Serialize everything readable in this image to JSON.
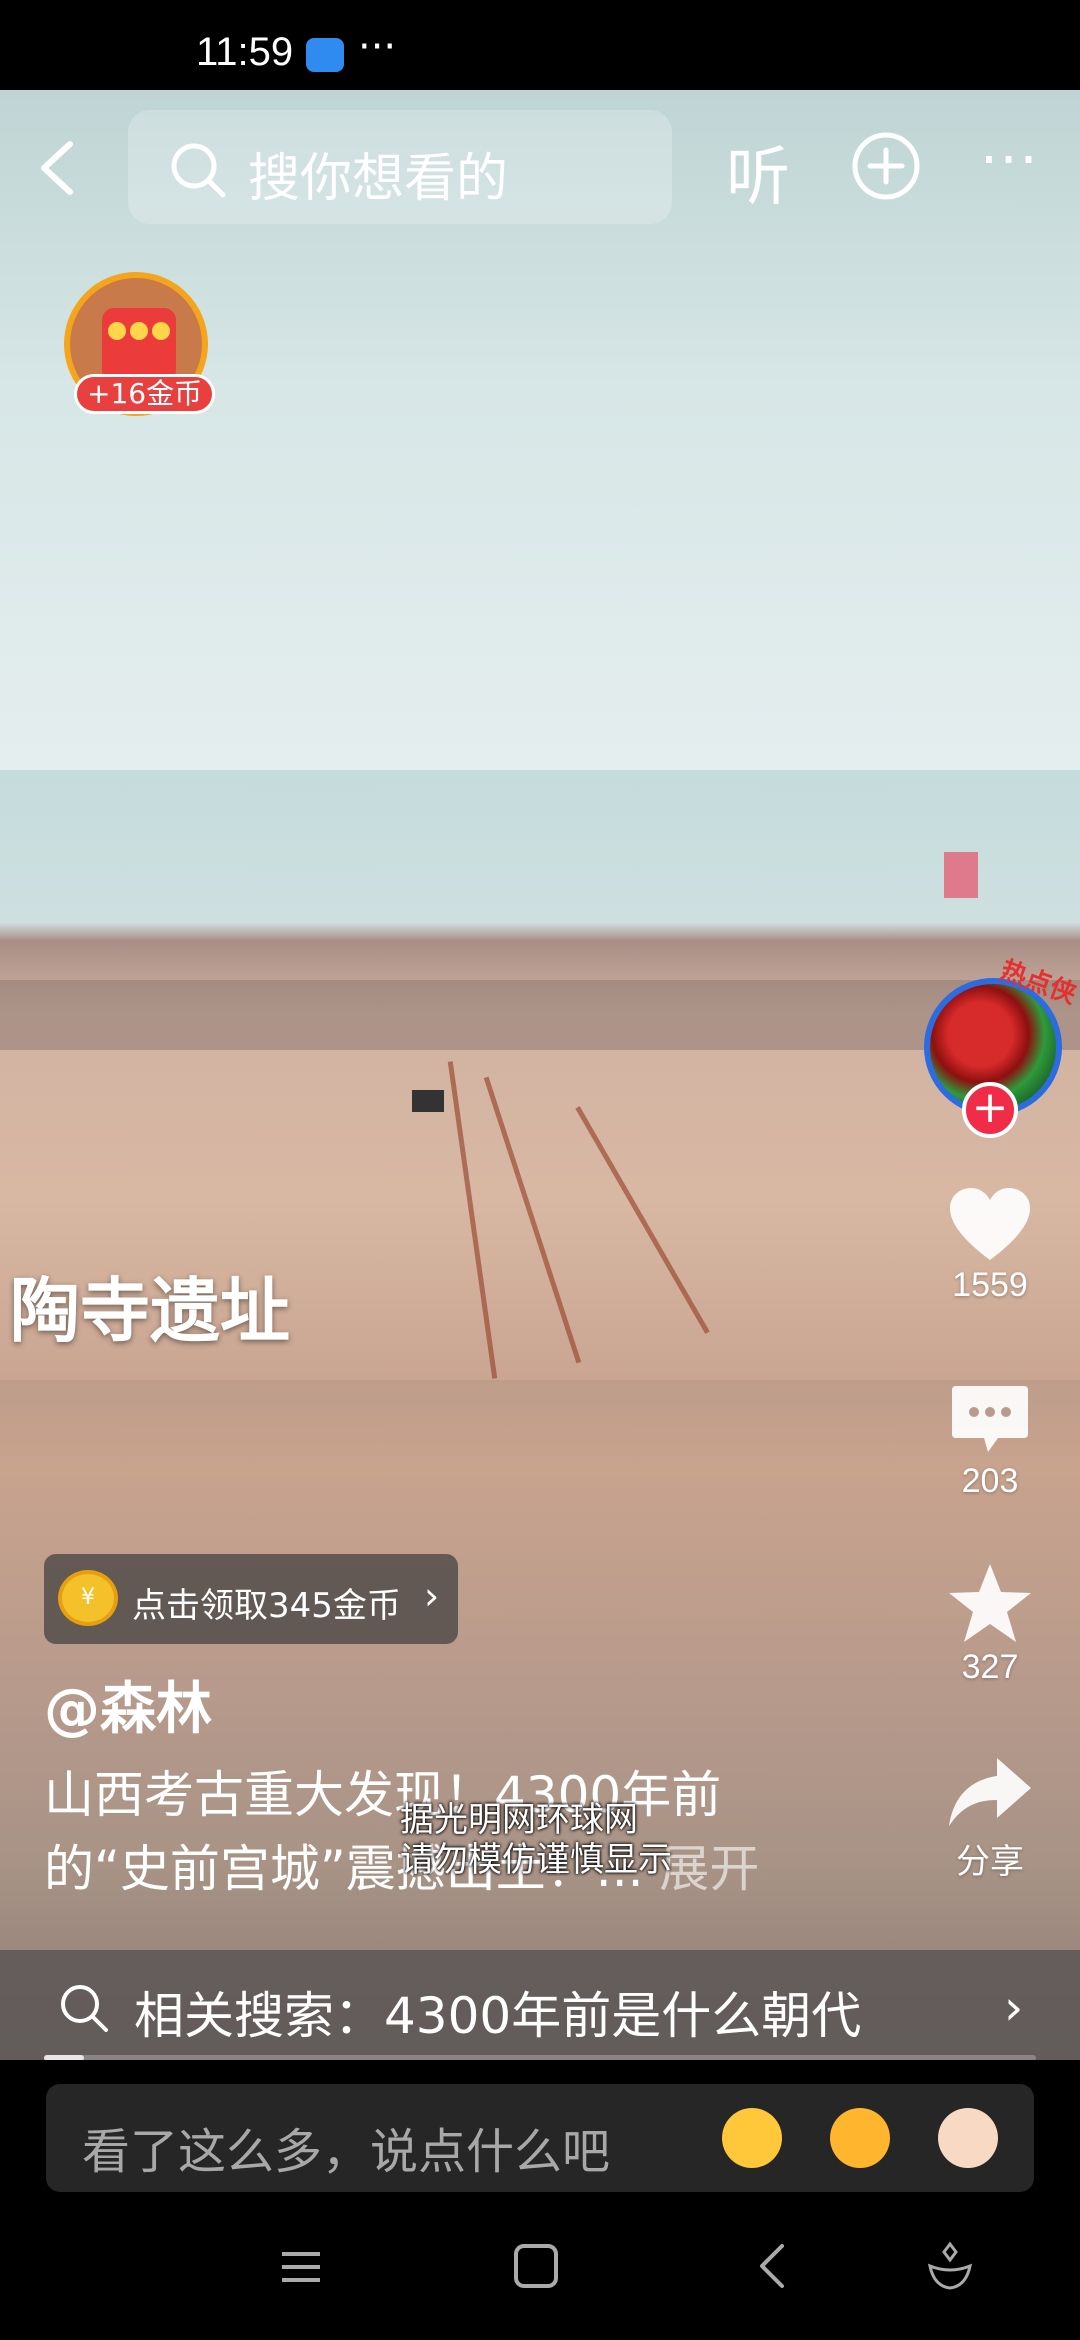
{
  "status_bar": {
    "time": "11:59",
    "more": "···"
  },
  "top_bar": {
    "search_placeholder": "搜你想看的",
    "listen_label": "听",
    "more_label": "···"
  },
  "coin_badge": {
    "label": "+16金币"
  },
  "video": {
    "caption": "陶寺遗址",
    "watermark_line1": "据光明网环球网",
    "watermark_line2": "请勿模仿谨慎显示"
  },
  "creator": {
    "avatar_tag": "热点侠"
  },
  "actions": {
    "like_count": "1559",
    "comment_count": "203",
    "favorite_count": "327",
    "share_label": "分享"
  },
  "promo": {
    "label": "点击领取345金币",
    "coin_symbol": "¥"
  },
  "post": {
    "author": "@森林",
    "description_line1": "山西考古重大发现！4300年前",
    "description_line2": "的“史前宫城”震撼出土！...",
    "expand_label": "展开"
  },
  "related_search": {
    "text": "相关搜索：4300年前是什么朝代"
  },
  "progress": {
    "played_fraction": 0.04
  },
  "comment_bar": {
    "placeholder": "看了这么多，说点什么吧"
  },
  "colors": {
    "like_red": "#f02c49",
    "accent_blue": "#2c6be0",
    "coin_gold": "#f4c12b"
  }
}
